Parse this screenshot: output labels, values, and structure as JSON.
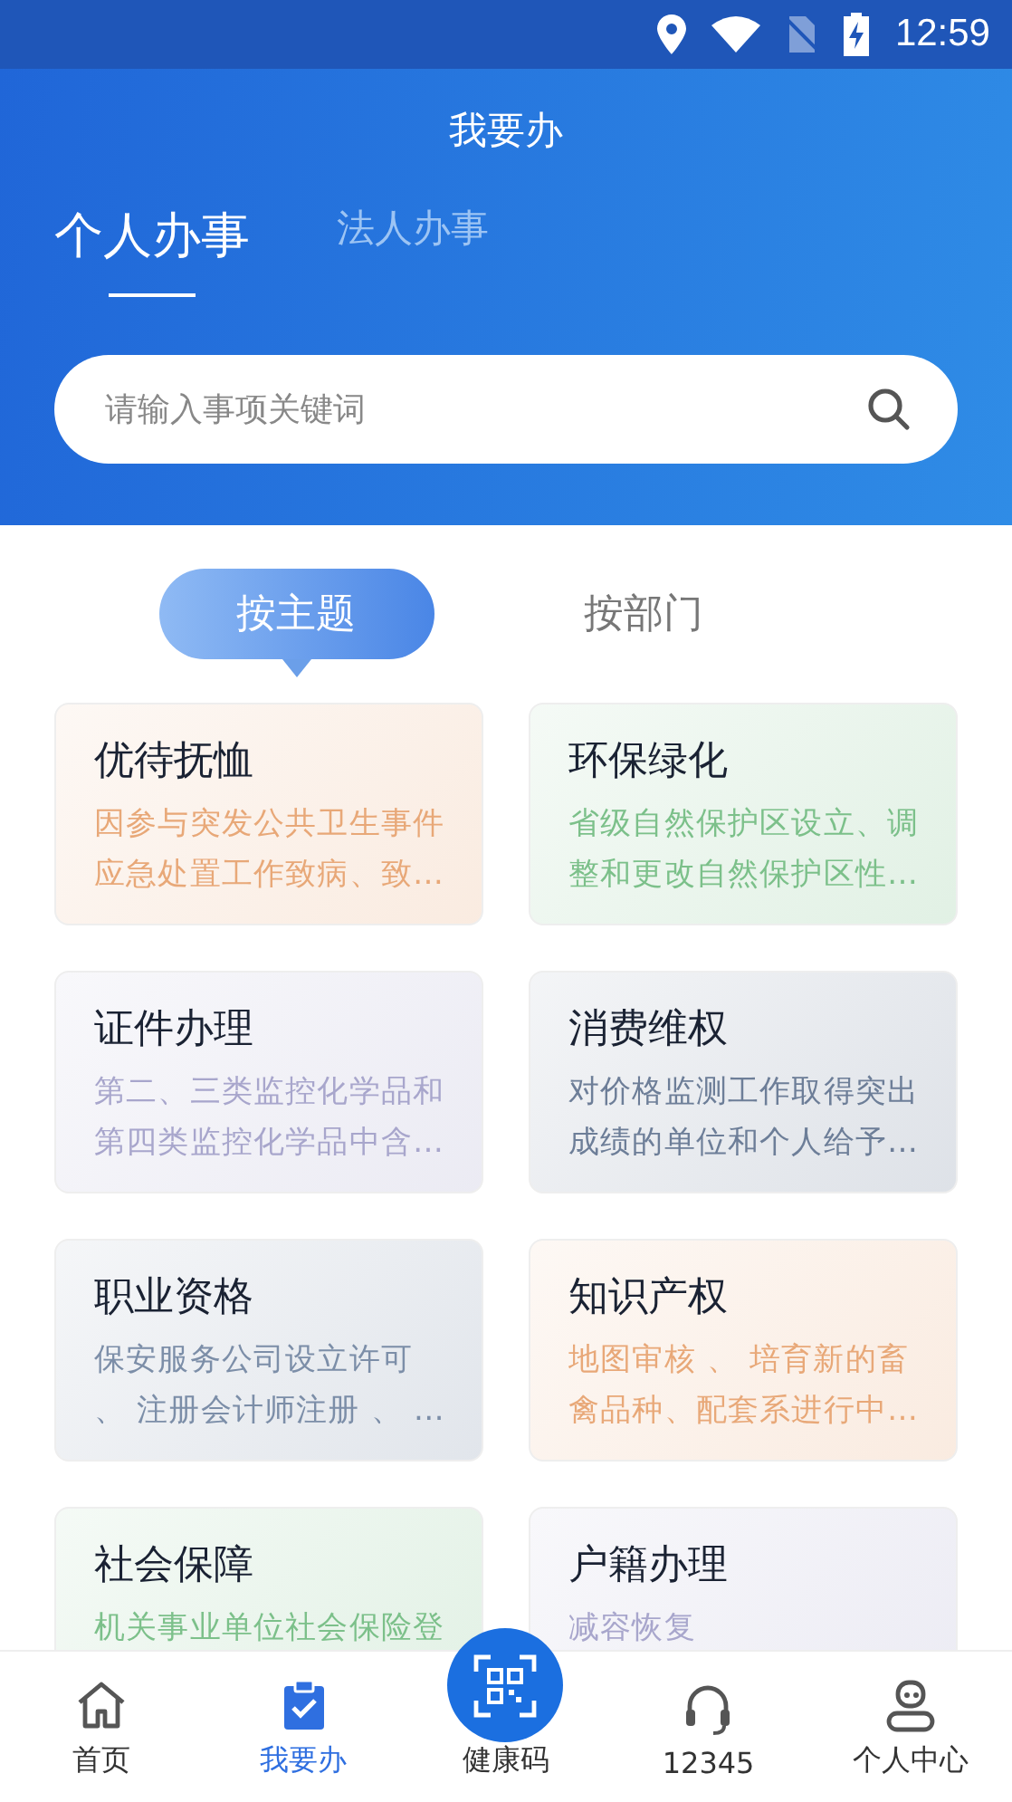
{
  "status_bar": {
    "time": "12:59"
  },
  "header": {
    "title": "我要办"
  },
  "tabs": [
    {
      "label": "个人办事",
      "selected": true
    },
    {
      "label": "法人办事",
      "selected": false
    }
  ],
  "search": {
    "placeholder": "请输入事项关键词"
  },
  "segments": [
    {
      "label": "按主题",
      "selected": true
    },
    {
      "label": "按部门",
      "selected": false
    }
  ],
  "cards": [
    {
      "title": "优待抚恤",
      "color": "#e8a878",
      "lines": [
        "因参与突发公共卫生事件",
        "应急处置工作致病、致…"
      ]
    },
    {
      "title": "环保绿化",
      "color": "#7cc08a",
      "lines": [
        "省级自然保护区设立、调",
        "整和更改自然保护区性…"
      ]
    },
    {
      "title": "证件办理",
      "color": "#a8a6cc",
      "lines": [
        "第二、三类监控化学品和",
        "第四类监控化学品中含…"
      ]
    },
    {
      "title": "消费维权",
      "color": "#6d7e98",
      "lines": [
        "对价格监测工作取得突出",
        "成绩的单位和个人给予…"
      ]
    },
    {
      "title": "职业资格",
      "color": "#7c8ea8",
      "lines": [
        "保安服务公司设立许可",
        "、 注册会计师注册 、 …"
      ]
    },
    {
      "title": "知识产权",
      "color": "#e8a878",
      "lines": [
        "地图审核 、 培育新的畜",
        "禽品种、配套系进行中…"
      ]
    },
    {
      "title": "社会保障",
      "color": "#7cc08a",
      "lines": [
        "机关事业单位社会保险登"
      ]
    },
    {
      "title": "户籍办理",
      "color": "#a8a6cc",
      "lines": [
        "减容恢复"
      ]
    }
  ],
  "nav": [
    {
      "label": "首页",
      "kind": "home",
      "selected": false
    },
    {
      "label": "我要办",
      "kind": "task",
      "selected": true
    },
    {
      "label": "健康码",
      "kind": "qr",
      "selected": false
    },
    {
      "label": "12345",
      "kind": "phone",
      "selected": false
    },
    {
      "label": "个人中心",
      "kind": "user",
      "selected": false
    }
  ]
}
